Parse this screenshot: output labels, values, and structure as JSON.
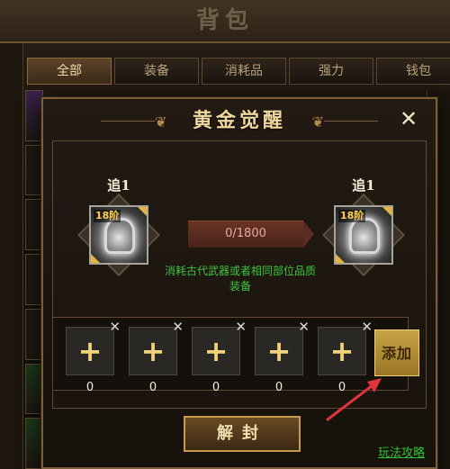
{
  "background": {
    "title": "背包",
    "tabs": [
      "全部",
      "装备",
      "消耗品",
      "强力",
      "钱包"
    ]
  },
  "modal": {
    "title": "黄金觉醒",
    "close_label": "✕",
    "left_item": {
      "label": "追1",
      "tier": "18阶"
    },
    "right_item": {
      "label": "追1",
      "tier": "18阶"
    },
    "progress": {
      "text": "0/1800",
      "current": 0,
      "max": 1800
    },
    "hint": "消耗古代武器或者相同部位品质装备",
    "slots": [
      {
        "plus": "+",
        "remove": "✕",
        "count": "0"
      },
      {
        "plus": "+",
        "remove": "✕",
        "count": "0"
      },
      {
        "plus": "+",
        "remove": "✕",
        "count": "0"
      },
      {
        "plus": "+",
        "remove": "✕",
        "count": "0"
      },
      {
        "plus": "+",
        "remove": "✕",
        "count": "0"
      }
    ],
    "add_button": "添加",
    "unseal_button": "解封",
    "guide_link": "玩法攻略"
  },
  "colors": {
    "gold": "#f0d79c",
    "hint_green": "#3ec63e",
    "annotation_red": "#e0333a"
  }
}
